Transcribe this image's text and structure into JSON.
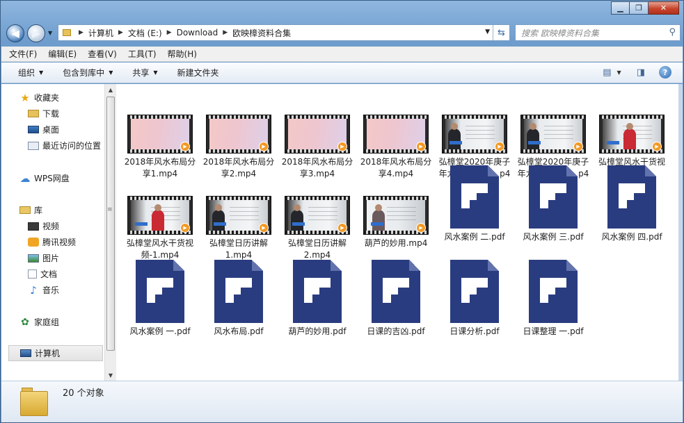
{
  "window": {
    "controls": {
      "minimize": "▁",
      "maximize": "❐",
      "close": "✕"
    }
  },
  "address_bar": {
    "crumbs": [
      "计算机",
      "文档 (E:)",
      "Download",
      "欧映樟资料合集"
    ]
  },
  "search": {
    "placeholder": "搜索 欧映樟资料合集"
  },
  "menu": [
    "文件(F)",
    "编辑(E)",
    "查看(V)",
    "工具(T)",
    "帮助(H)"
  ],
  "toolbar": {
    "organize": "组织",
    "include_library": "包含到库中",
    "share": "共享",
    "new_folder": "新建文件夹"
  },
  "sidebar": {
    "favorites": {
      "label": "收藏夹",
      "items": [
        "下载",
        "桌面",
        "最近访问的位置"
      ]
    },
    "wps": "WPS网盘",
    "library": {
      "label": "库",
      "items": [
        "视频",
        "腾讯视频",
        "图片",
        "文档",
        "音乐"
      ]
    },
    "homegroup": "家庭组",
    "computer": "计算机"
  },
  "files": [
    {
      "name": "2018年风水布局分享1.mp4",
      "type": "video",
      "thumb": "pink"
    },
    {
      "name": "2018年风水布局分享2.mp4",
      "type": "video",
      "thumb": "pink"
    },
    {
      "name": "2018年风水布局分享3.mp4",
      "type": "video",
      "thumb": "pink"
    },
    {
      "name": "2018年风水布局分享4.mp4",
      "type": "video",
      "thumb": "pink"
    },
    {
      "name": "弘樟堂2020年庚子年九星布局二.mp4",
      "type": "video",
      "thumb": "board"
    },
    {
      "name": "弘樟堂2020年庚子年九星布局一.mp4",
      "type": "video",
      "thumb": "board"
    },
    {
      "name": "弘樟堂风水干货视频.mp4",
      "type": "video",
      "thumb": "board-red"
    },
    {
      "name": "弘樟堂风水干货视频-1.mp4",
      "type": "video",
      "thumb": "board-red"
    },
    {
      "name": "弘樟堂日历讲解1.mp4",
      "type": "video",
      "thumb": "board"
    },
    {
      "name": "弘樟堂日历讲解2.mp4",
      "type": "video",
      "thumb": "board"
    },
    {
      "name": "葫芦的妙用.mp4",
      "type": "video",
      "thumb": "board2"
    },
    {
      "name": "风水案例 二.pdf",
      "type": "pdf"
    },
    {
      "name": "风水案例 三.pdf",
      "type": "pdf"
    },
    {
      "name": "风水案例 四.pdf",
      "type": "pdf"
    },
    {
      "name": "风水案例 一.pdf",
      "type": "pdf"
    },
    {
      "name": "风水布局.pdf",
      "type": "pdf"
    },
    {
      "name": "葫芦的妙用.pdf",
      "type": "pdf"
    },
    {
      "name": "日课的吉凶.pdf",
      "type": "pdf"
    },
    {
      "name": "日课分析.pdf",
      "type": "pdf"
    },
    {
      "name": "日课整理 一.pdf",
      "type": "pdf"
    }
  ],
  "status": {
    "count_text": "20 个对象"
  }
}
